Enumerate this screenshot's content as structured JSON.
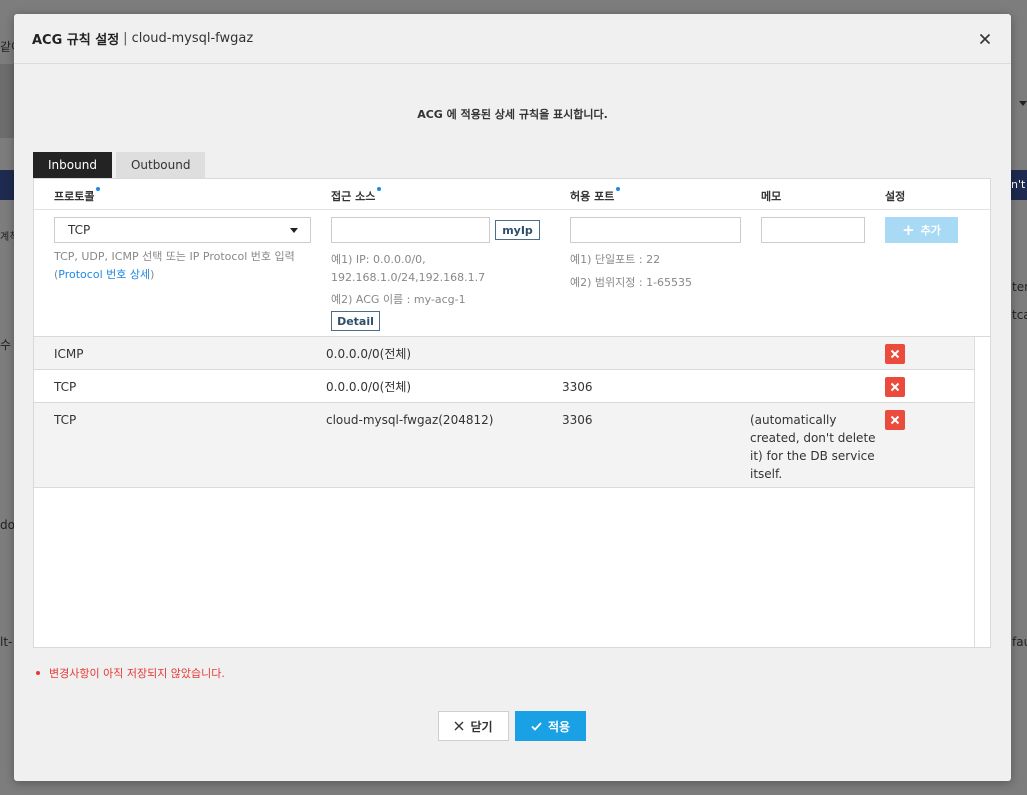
{
  "background": {
    "frag_left_top": "같이",
    "frag_left_mid1": "계칙",
    "frag_left_mid2": "수",
    "frag_left_mid3": "dor",
    "frag_left_low": "lt-",
    "frag_right_navy": "n't",
    "frag_right_1": "ter",
    "frag_right_2": "tca",
    "frag_right_3": "fau"
  },
  "modal": {
    "title": "ACG 규칙 설정",
    "separator": "|",
    "subtitle": "cloud-mysql-fwgaz",
    "description": "ACG 에 적용된 상세 규칙을 표시합니다."
  },
  "tabs": [
    {
      "label": "Inbound",
      "active": true
    },
    {
      "label": "Outbound",
      "active": false
    }
  ],
  "columns": {
    "protocol": "프로토콜",
    "source": "접근 소스",
    "port": "허용 포트",
    "memo": "메모",
    "settings": "설정"
  },
  "form": {
    "protocol_value": "TCP",
    "protocol_help": "TCP, UDP, ICMP 선택 또는 IP Protocol 번호 입력",
    "protocol_link_open": "(",
    "protocol_link": "Protocol 번호 상세",
    "protocol_link_close": ")",
    "source_value": "",
    "myip_label": "myIp",
    "source_help1_line1": "예1) IP: 0.0.0.0/0,",
    "source_help1_line2": "192.168.1.0/24,192.168.1.7",
    "source_help2": "예2) ACG 이름 : my-acg-1",
    "detail_label": "Detail",
    "port_value": "",
    "port_help1": "예1) 단일포트 : 22",
    "port_help2": "예2) 범위지정 : 1-65535",
    "memo_value": "",
    "add_label": "추가"
  },
  "rules": [
    {
      "protocol": "ICMP",
      "source": "0.0.0.0/0(전체)",
      "port": "",
      "memo": ""
    },
    {
      "protocol": "TCP",
      "source": "0.0.0.0/0(전체)",
      "port": "3306",
      "memo": ""
    },
    {
      "protocol": "TCP",
      "source": "cloud-mysql-fwgaz(204812)",
      "port": "3306",
      "memo_lines": [
        "(automatically",
        "created, don't delete",
        "it) for the DB service",
        "itself."
      ]
    }
  ],
  "warning": "변경사항이 아직 저장되지 않았습니다.",
  "footer": {
    "close_label": "닫기",
    "apply_label": "적용"
  },
  "colors": {
    "accent": "#1aa0e4",
    "delete": "#ea4b3c",
    "warning": "#e53935",
    "tab_active": "#232323"
  }
}
